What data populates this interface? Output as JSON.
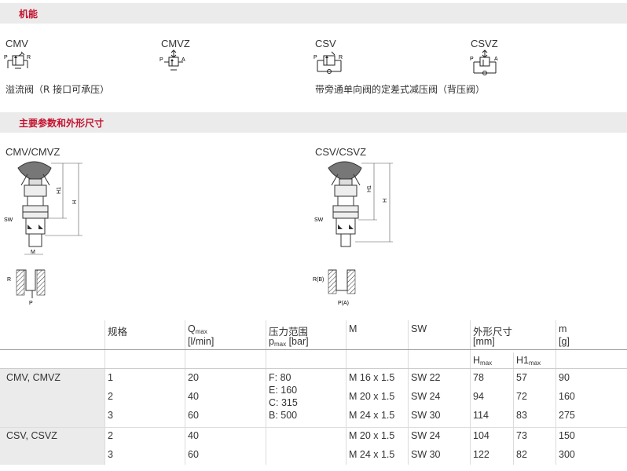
{
  "sections": {
    "functions_title": "机能",
    "params_title": "主要参数和外形尺寸"
  },
  "functions": [
    {
      "name": "CMV"
    },
    {
      "name": "CMVZ"
    },
    {
      "name": "CSV"
    },
    {
      "name": "CSVZ"
    }
  ],
  "descriptions": {
    "left": "溢流阀（R 接口可承压）",
    "right": "带旁通单向阀的定差式减压阀（背压阀）"
  },
  "drawings": {
    "left_title": "CMV/CMVZ",
    "right_title": "CSV/CSVZ",
    "labels": {
      "H": "H",
      "H1": "H1",
      "SW": "SW",
      "M": "M",
      "R": "R",
      "P": "P",
      "RB": "R(B)",
      "PA": "P(A)"
    }
  },
  "table": {
    "headers": {
      "size": "规格",
      "q": "Q",
      "q_sub": "max",
      "q_unit": "[l/min]",
      "pressure": "压力范围",
      "p": "p",
      "p_sub": "max",
      "p_unit": "[bar]",
      "m": "M",
      "sw": "SW",
      "dims": "外形尺寸",
      "dims_unit": "[mm]",
      "mass": "m",
      "mass_unit": "[g]",
      "h": "H",
      "h_sub": "max",
      "h1": "H1",
      "h1_sub": "max"
    },
    "groups": [
      {
        "label": "CMV, CMVZ",
        "pressure_ranges": [
          "F: 80",
          "E: 160",
          "C: 315",
          "B: 500"
        ]
      },
      {
        "label": "CSV, CSVZ"
      }
    ],
    "rows": [
      {
        "size": "1",
        "q": "20",
        "m": "M 16 x 1.5",
        "sw": "SW 22",
        "h": "78",
        "h1": "57",
        "mass": "90"
      },
      {
        "size": "2",
        "q": "40",
        "m": "M 20 x 1.5",
        "sw": "SW 24",
        "h": "94",
        "h1": "72",
        "mass": "160"
      },
      {
        "size": "3",
        "q": "60",
        "m": "M 24 x 1.5",
        "sw": "SW 30",
        "h": "114",
        "h1": "83",
        "mass": "275"
      },
      {
        "size": "2",
        "q": "40",
        "m": "M 20 x 1.5",
        "sw": "SW 24",
        "h": "104",
        "h1": "73",
        "mass": "150"
      },
      {
        "size": "3",
        "q": "60",
        "m": "M 24 x 1.5",
        "sw": "SW 30",
        "h": "122",
        "h1": "82",
        "mass": "300"
      }
    ]
  }
}
